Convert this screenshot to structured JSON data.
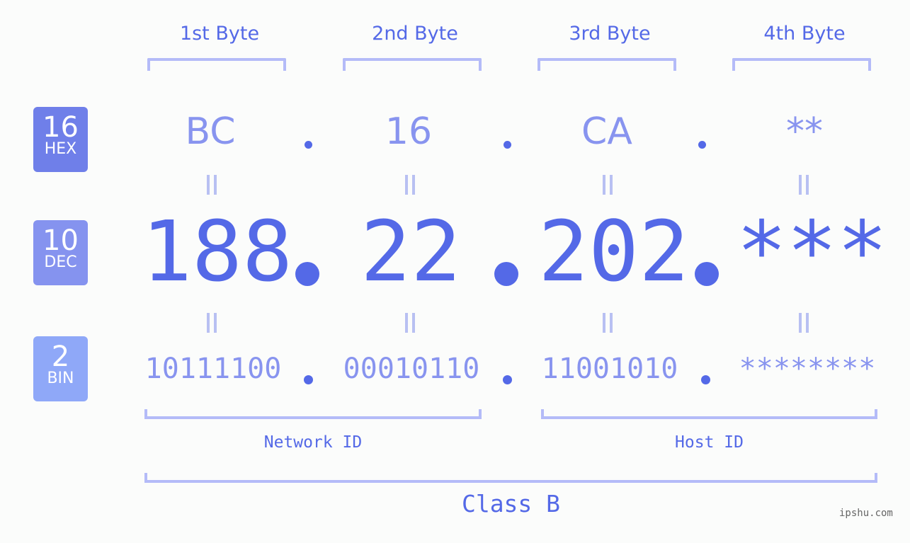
{
  "byte_headers": [
    "1st Byte",
    "2nd Byte",
    "3rd Byte",
    "4th Byte"
  ],
  "badges": {
    "hex": {
      "num": "16",
      "label": "HEX",
      "color": "#6f7fe9"
    },
    "dec": {
      "num": "10",
      "label": "DEC",
      "color": "#8593ef"
    },
    "bin": {
      "num": "2",
      "label": "BIN",
      "color": "#8fa8f8"
    }
  },
  "hex": [
    "BC",
    "16",
    "CA",
    "**"
  ],
  "dec": [
    "188",
    "22",
    "202",
    "***"
  ],
  "bin": [
    "10111100",
    "00010110",
    "11001010",
    "********"
  ],
  "equals_symbol": "=",
  "network_label": "Network ID",
  "host_label": "Host ID",
  "class_label": "Class B",
  "watermark": "ipshu.com",
  "colors": {
    "accent": "#5469e7",
    "light": "#8894ef",
    "bracket": "#b4bbf8",
    "background": "#fbfcfb"
  }
}
